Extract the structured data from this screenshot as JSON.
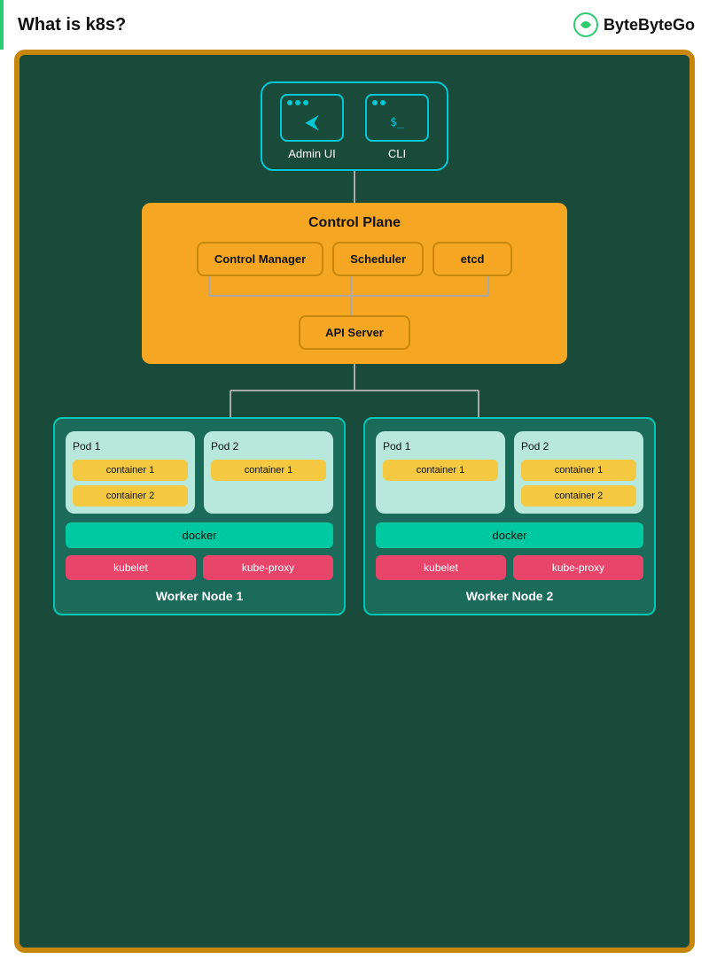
{
  "header": {
    "title": "What is k8s?",
    "logo_text": "ByteByteGo"
  },
  "diagram": {
    "admin_ui": {
      "label": "Admin UI"
    },
    "cli": {
      "label": "CLI"
    },
    "control_plane": {
      "title": "Control Plane",
      "control_manager": "Control Manager",
      "scheduler": "Scheduler",
      "etcd": "etcd",
      "api_server": "API Server"
    },
    "worker_node_1": {
      "title": "Worker Node 1",
      "pod1": {
        "label": "Pod 1",
        "containers": [
          "container 1",
          "container 2"
        ]
      },
      "pod2": {
        "label": "Pod 2",
        "containers": [
          "container 1"
        ]
      },
      "docker": "docker",
      "kubelet": "kubelet",
      "kube_proxy": "kube-proxy"
    },
    "worker_node_2": {
      "title": "Worker Node 2",
      "pod1": {
        "label": "Pod 1",
        "containers": [
          "container 1"
        ]
      },
      "pod2": {
        "label": "Pod 2",
        "containers": [
          "container 1",
          "container 2"
        ]
      },
      "docker": "docker",
      "kubelet": "kubelet",
      "kube_proxy": "kube-proxy"
    }
  }
}
